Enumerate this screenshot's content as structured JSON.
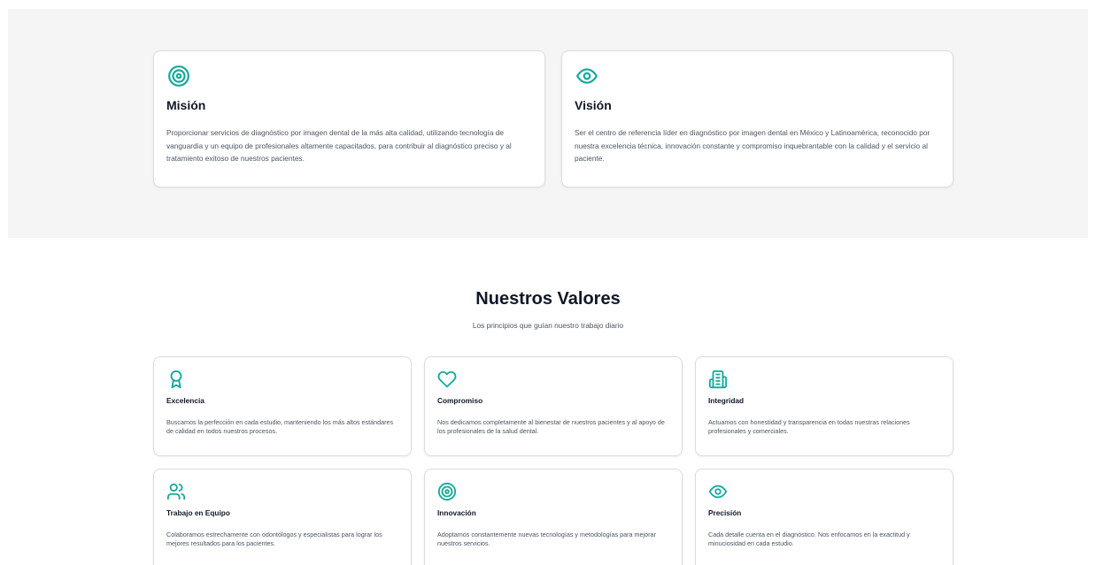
{
  "mision": {
    "icon": "target-icon",
    "title": "Misión",
    "text": "Proporcionar servicios de diagnóstico por imagen dental de la más alta calidad, utilizando tecnología de vanguardia y un equipo de profesionales altamente capacitados, para contribuir al diagnóstico preciso y al tratamiento exitoso de nuestros pacientes."
  },
  "vision": {
    "icon": "eye-icon",
    "title": "Visión",
    "text": "Ser el centro de referencia líder en diagnóstico por imagen dental en México y Latinoamérica, reconocido por nuestra excelencia técnica, innovación constante y compromiso inquebrantable con la calidad y el servicio al paciente."
  },
  "values": {
    "heading": "Nuestros Valores",
    "subtitle": "Los principios que guían nuestro trabajo diario",
    "items": [
      {
        "icon": "award-icon",
        "title": "Excelencia",
        "text": "Buscamos la perfección en cada estudio, manteniendo los más altos estándares de calidad en todos nuestros procesos."
      },
      {
        "icon": "heart-icon",
        "title": "Compromiso",
        "text": "Nos dedicamos completamente al bienestar de nuestros pacientes y al apoyo de los profesionales de la salud dental."
      },
      {
        "icon": "building-icon",
        "title": "Integridad",
        "text": "Actuamos con honestidad y transparencia en todas nuestras relaciones profesionales y comerciales."
      },
      {
        "icon": "users-icon",
        "title": "Trabajo en Equipo",
        "text": "Colaboramos estrechamente con odontólogos y especialistas para lograr los mejores resultados para los pacientes."
      },
      {
        "icon": "target-icon",
        "title": "Innovación",
        "text": "Adoptamos constantemente nuevas tecnologías y metodologías para mejorar nuestros servicios."
      },
      {
        "icon": "eye-icon",
        "title": "Precisión",
        "text": "Cada detalle cuenta en el diagnóstico. Nos enfocamos en la exactitud y minuciosidad en cada estudio."
      }
    ]
  },
  "colors": {
    "accent": "#14a89a",
    "section_bg": "#f5f5f5",
    "border": "#dcdcdc"
  }
}
